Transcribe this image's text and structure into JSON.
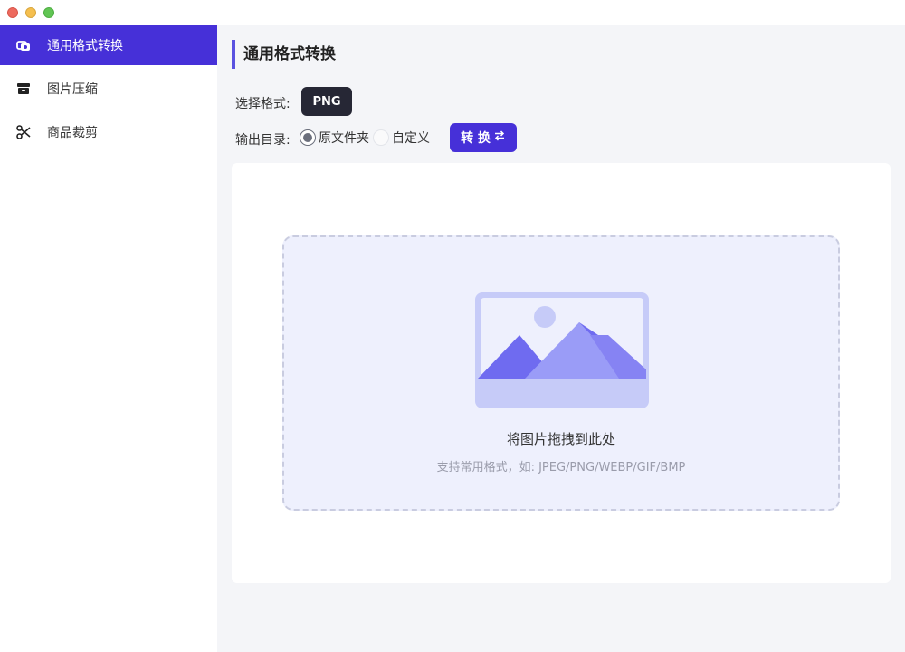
{
  "sidebar": {
    "items": [
      {
        "label": "通用格式转换",
        "icon": "convert-icon",
        "active": true
      },
      {
        "label": "图片压缩",
        "icon": "archive-icon",
        "active": false
      },
      {
        "label": "商品裁剪",
        "icon": "scissors-icon",
        "active": false
      }
    ]
  },
  "main": {
    "title": "通用格式转换",
    "format": {
      "label": "选择格式:",
      "selected": "PNG"
    },
    "output": {
      "label": "输出目录:",
      "options": [
        {
          "label": "原文件夹",
          "checked": true
        },
        {
          "label": "自定义",
          "checked": false
        }
      ]
    },
    "convert_button": {
      "label": "转 换",
      "icon": "swap-arrows-icon"
    },
    "dropzone": {
      "title": "将图片拖拽到此处",
      "subtitle": "支持常用格式，如: JPEG/PNG/WEBP/GIF/BMP",
      "icon": "image-placeholder-icon"
    }
  },
  "colors": {
    "accent": "#4630d8",
    "title_bar_accent": "#5a52e0",
    "dark_button": "#262735",
    "dropzone_bg": "#eef0fd"
  }
}
